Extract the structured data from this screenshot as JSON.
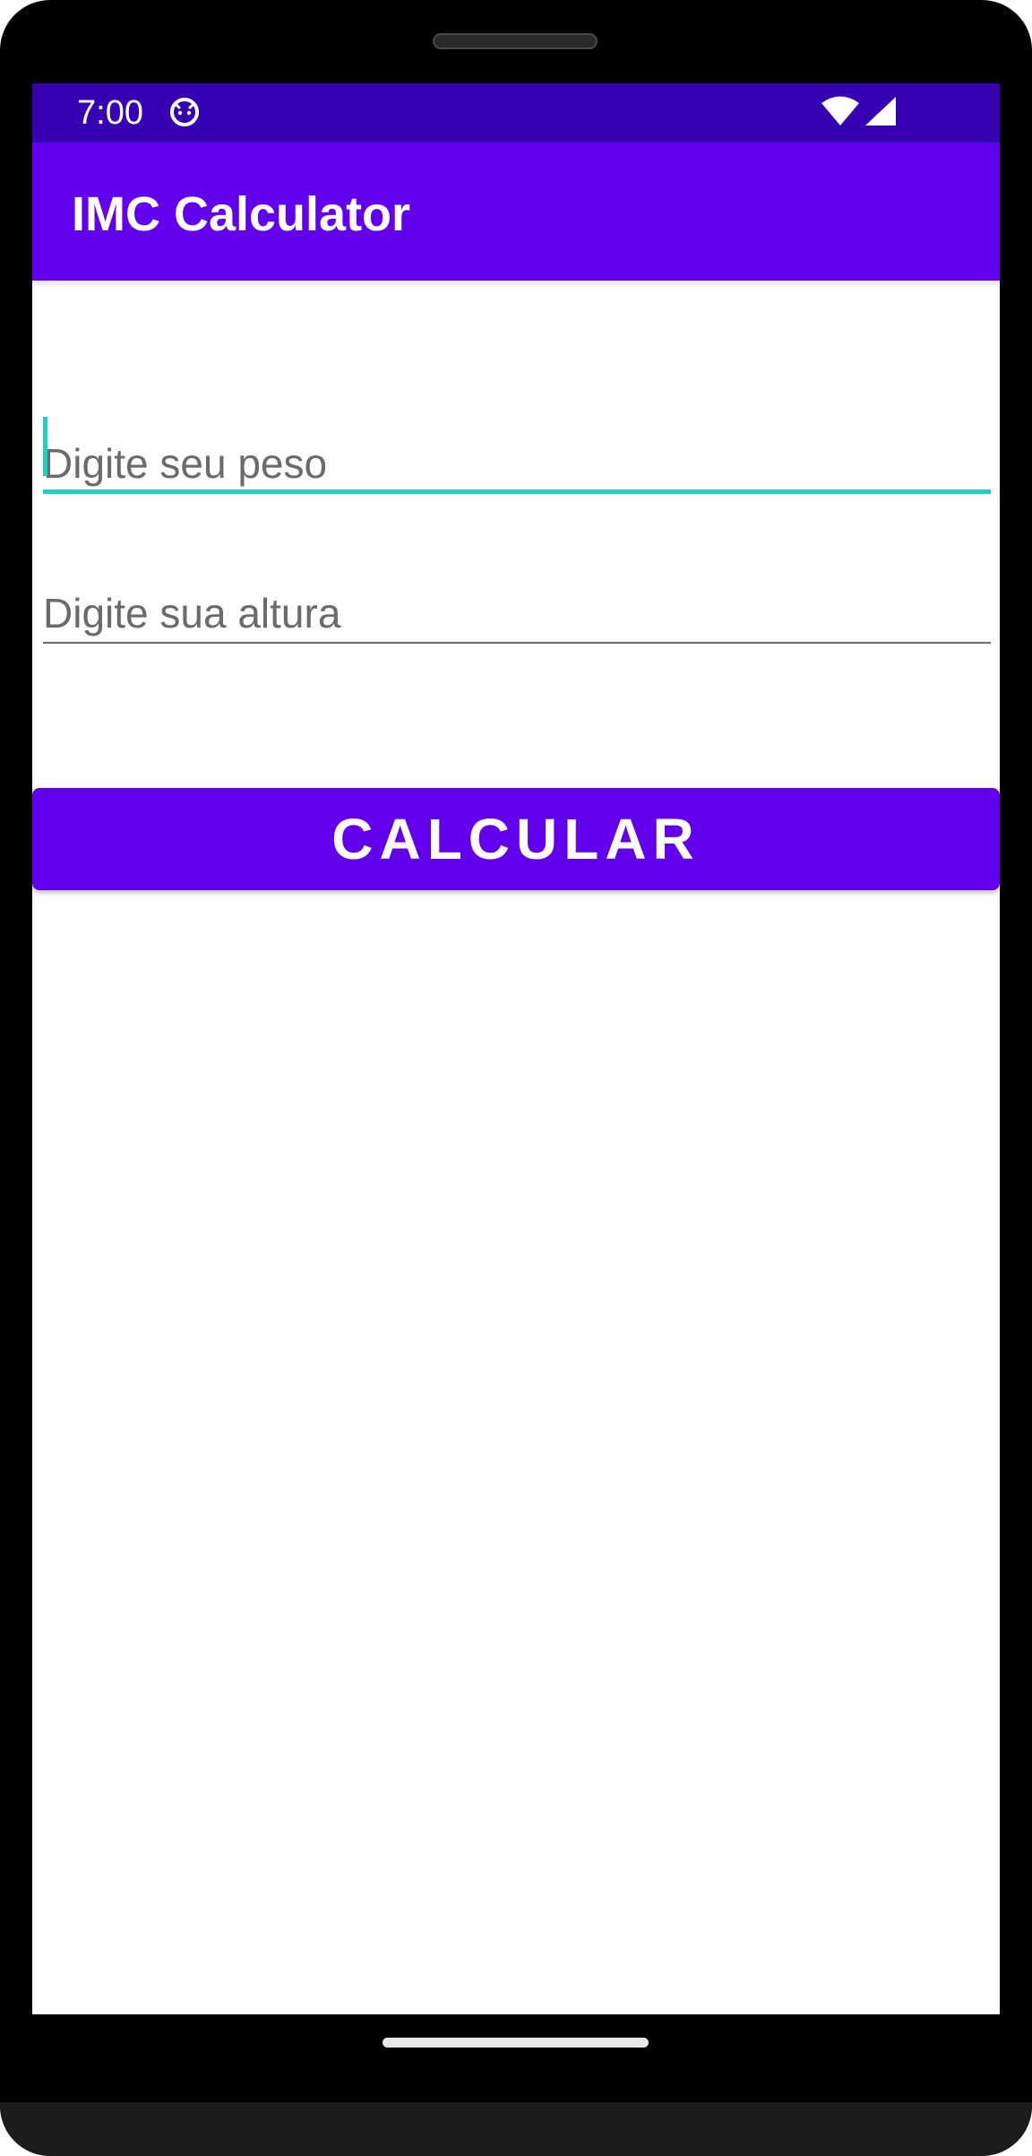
{
  "status_bar": {
    "time": "7:00",
    "app_icon": "android-notification-icon",
    "wifi_icon": "wifi-icon",
    "signal_icon": "cellular-signal-icon"
  },
  "app_bar": {
    "title": "IMC Calculator"
  },
  "form": {
    "weight_placeholder": "Digite seu peso",
    "weight_value": "",
    "height_placeholder": "Digite sua altura",
    "height_value": ""
  },
  "calculate_button": {
    "label": "CALCULAR"
  },
  "colors": {
    "primary": "#6200ee",
    "primary_dark": "#3700b3",
    "accent": "#03dac5",
    "on_primary": "#ffffff"
  }
}
